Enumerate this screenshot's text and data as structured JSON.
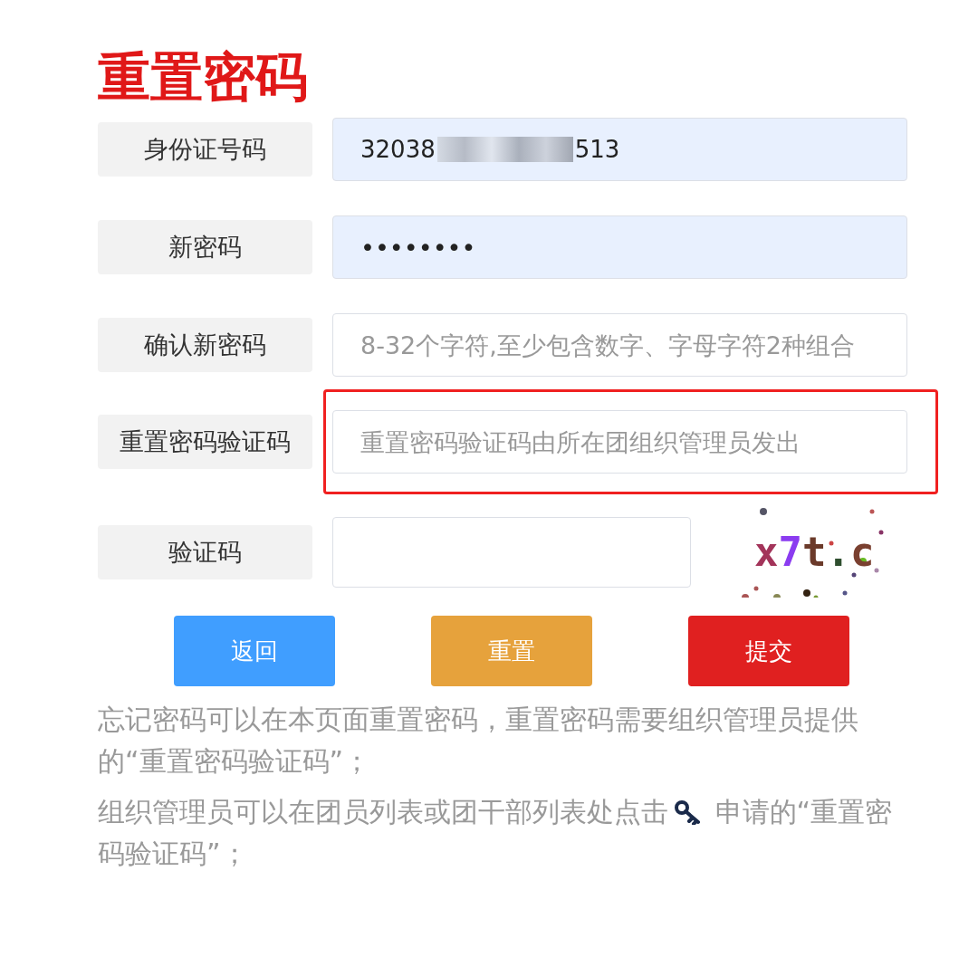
{
  "title": "重置密码",
  "fields": [
    {
      "label": "身份证号码",
      "kind": "redacted",
      "value_start": "32038",
      "value_end": "513",
      "autofilled": true
    },
    {
      "label": "新密码",
      "kind": "password",
      "value": "••••••••",
      "autofilled": true
    },
    {
      "label": "确认新密码",
      "kind": "text",
      "placeholder": "8-32个字符,至少包含数字、字母字符2种组合",
      "autofilled": false
    },
    {
      "label": "重置密码验证码",
      "kind": "text",
      "placeholder": "重置密码验证码由所在团组织管理员发出",
      "autofilled": false,
      "highlighted": true
    },
    {
      "label": "验证码",
      "kind": "captcha",
      "autofilled": false,
      "captcha": [
        {
          "char": "x",
          "color": "#a3345a"
        },
        {
          "char": "7",
          "color": "#8b3cf0"
        },
        {
          "char": "t",
          "color": "#6b3a2a"
        },
        {
          "char": ".",
          "color": "#2f4f2f"
        },
        {
          "char": "c",
          "color": "#7a4030"
        }
      ]
    }
  ],
  "buttons": [
    {
      "label": "返回",
      "color": "#409eff"
    },
    {
      "label": "重置",
      "color": "#e6a23c"
    },
    {
      "label": "提交",
      "color": "#e02020"
    }
  ],
  "notes": [
    {
      "text": "忘记密码可以在本页面重置密码，重置密码需要组织管理员提供的“重置密码验证码”；"
    },
    {
      "text_before": "组织管理员可以在团员列表或团干部列表处点击",
      "text_after": " 申请的“重置密码验证码”；"
    }
  ]
}
